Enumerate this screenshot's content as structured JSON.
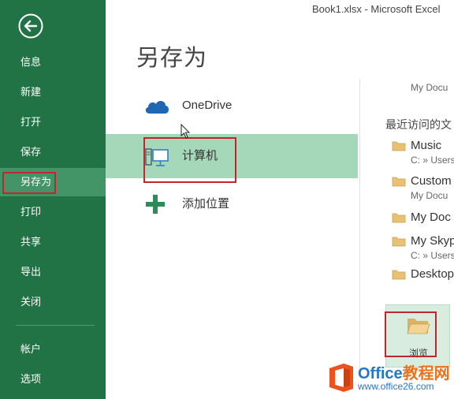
{
  "window": {
    "title": "Book1.xlsx - Microsoft Excel"
  },
  "sidebar": {
    "items": [
      {
        "label": "信息"
      },
      {
        "label": "新建"
      },
      {
        "label": "打开"
      },
      {
        "label": "保存"
      },
      {
        "label": "另存为"
      },
      {
        "label": "打印"
      },
      {
        "label": "共享"
      },
      {
        "label": "导出"
      },
      {
        "label": "关闭"
      },
      {
        "label": "帐户"
      },
      {
        "label": "选项"
      }
    ],
    "active": "另存为"
  },
  "main": {
    "title": "另存为"
  },
  "places": [
    {
      "label": "OneDrive",
      "icon": "cloud-icon"
    },
    {
      "label": "计算机",
      "icon": "computer-icon",
      "selected": true
    },
    {
      "label": "添加位置",
      "icon": "plus-icon"
    }
  ],
  "recent": {
    "top_path": "My Docu",
    "heading": "最近访问的文",
    "folders": [
      {
        "name": "Music",
        "path": "C: » Users"
      },
      {
        "name": "Custom",
        "path": "My Docu"
      },
      {
        "name": "My Doc",
        "path": ""
      },
      {
        "name": "My Skyp",
        "path": "C: » Users"
      },
      {
        "name": "Desktop",
        "path": ""
      }
    ],
    "browse_label": "浏览"
  },
  "watermark": {
    "brand": "Office",
    "brand_cn": "教程网",
    "url": "www.office26.com"
  },
  "colors": {
    "sidebar": "#217346",
    "sidebar_active": "#439467",
    "selected_place": "#a5d7b9",
    "highlight_box": "#c0262b"
  }
}
